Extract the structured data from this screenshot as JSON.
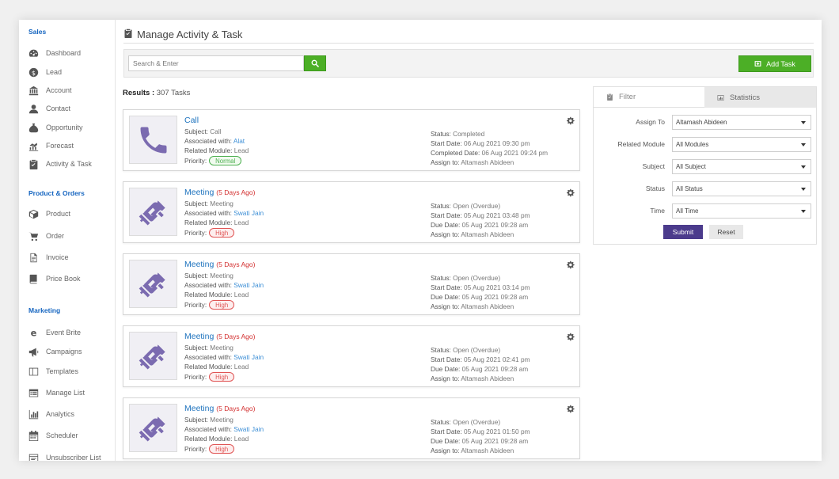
{
  "sidebar": {
    "sections": [
      {
        "title": "Sales",
        "items": [
          {
            "label": "Dashboard",
            "icon": "dashboard-icon"
          },
          {
            "label": "Lead",
            "icon": "dollar-icon"
          },
          {
            "label": "Account",
            "icon": "bank-icon"
          },
          {
            "label": "Contact",
            "icon": "user-icon"
          },
          {
            "label": "Opportunity",
            "icon": "money-bag-icon"
          },
          {
            "label": "Forecast",
            "icon": "chart-icon"
          },
          {
            "label": "Activity & Task",
            "icon": "clipboard-icon"
          }
        ]
      },
      {
        "title": "Product & Orders",
        "items": [
          {
            "label": "Product",
            "icon": "cube-icon"
          },
          {
            "label": "Order",
            "icon": "cart-icon"
          },
          {
            "label": "Invoice",
            "icon": "document-icon"
          },
          {
            "label": "Price Book",
            "icon": "book-icon"
          }
        ]
      },
      {
        "title": "Marketing",
        "items": [
          {
            "label": "Event Brite",
            "icon": "e-icon"
          },
          {
            "label": "Campaigns",
            "icon": "megaphone-icon"
          },
          {
            "label": "Templates",
            "icon": "template-icon"
          },
          {
            "label": "Manage List",
            "icon": "list-icon"
          },
          {
            "label": "Analytics",
            "icon": "bar-chart-icon"
          },
          {
            "label": "Scheduler",
            "icon": "calendar-icon"
          },
          {
            "label": "Unsubscriber List",
            "icon": "unsubscribe-icon"
          }
        ]
      }
    ]
  },
  "header": {
    "title": "Manage Activity & Task",
    "icon": "clipboard-icon"
  },
  "toolbar": {
    "search_placeholder": "Search & Enter",
    "add_task_label": "Add Task"
  },
  "results": {
    "label": "Results :",
    "count_text": "307 Tasks"
  },
  "task_labels": {
    "subject": "Subject:",
    "associated": "Associated with:",
    "module": "Related Module:",
    "priority": "Priority:",
    "status": "Status:",
    "start": "Start Date:",
    "due": "Due Date:",
    "completed": "Completed Date:",
    "assign": "Assign to:"
  },
  "tasks": [
    {
      "title": "Call",
      "days_ago": "",
      "subject": "Call",
      "associated": "Alat",
      "module": "Lead",
      "priority": "Normal",
      "priority_level": "normal",
      "status": "Completed",
      "start": "06 Aug 2021 09:30 pm",
      "third_label_key": "completed",
      "third_value": "06 Aug 2021 09:24 pm",
      "assign": "Altamash Abideen",
      "icon": "phone-icon"
    },
    {
      "title": "Meeting",
      "days_ago": "(5 Days Ago)",
      "subject": "Meeting",
      "associated": "Swati Jain",
      "module": "Lead",
      "priority": "High",
      "priority_level": "high",
      "status": "Open (Overdue)",
      "start": "05 Aug 2021 03:48 pm",
      "third_label_key": "due",
      "third_value": "05 Aug 2021 09:28 am",
      "assign": "Altamash Abideen",
      "icon": "handshake-icon"
    },
    {
      "title": "Meeting",
      "days_ago": "(5 Days Ago)",
      "subject": "Meeting",
      "associated": "Swati Jain",
      "module": "Lead",
      "priority": "High",
      "priority_level": "high",
      "status": "Open (Overdue)",
      "start": "05 Aug 2021 03:14 pm",
      "third_label_key": "due",
      "third_value": "05 Aug 2021 09:28 am",
      "assign": "Altamash Abideen",
      "icon": "handshake-icon"
    },
    {
      "title": "Meeting",
      "days_ago": "(5 Days Ago)",
      "subject": "Meeting",
      "associated": "Swati Jain",
      "module": "Lead",
      "priority": "High",
      "priority_level": "high",
      "status": "Open (Overdue)",
      "start": "05 Aug 2021 02:41 pm",
      "third_label_key": "due",
      "third_value": "05 Aug 2021 09:28 am",
      "assign": "Altamash Abideen",
      "icon": "handshake-icon"
    },
    {
      "title": "Meeting",
      "days_ago": "(5 Days Ago)",
      "subject": "Meeting",
      "associated": "Swati Jain",
      "module": "Lead",
      "priority": "High",
      "priority_level": "high",
      "status": "Open (Overdue)",
      "start": "05 Aug 2021 01:50 pm",
      "third_label_key": "due",
      "third_value": "05 Aug 2021 09:28 am",
      "assign": "Altamash Abideen",
      "icon": "handshake-icon"
    }
  ],
  "filter": {
    "tabs": [
      {
        "label": "Filter",
        "icon": "clipboard-icon",
        "active": true
      },
      {
        "label": "Statistics",
        "icon": "stats-icon",
        "active": false
      }
    ],
    "fields": [
      {
        "label": "Assign To",
        "value": "Altamash Abideen"
      },
      {
        "label": "Related Module",
        "value": "All Modules"
      },
      {
        "label": "Subject",
        "value": "All Subject"
      },
      {
        "label": "Status",
        "value": "All Status"
      },
      {
        "label": "Time",
        "value": "All Time"
      }
    ],
    "submit_label": "Submit",
    "reset_label": "Reset"
  },
  "colors": {
    "accent_green": "#4caf26",
    "link_blue": "#1e73be",
    "submit_purple": "#4b3b8c",
    "overdue_red": "#d32f2f"
  }
}
